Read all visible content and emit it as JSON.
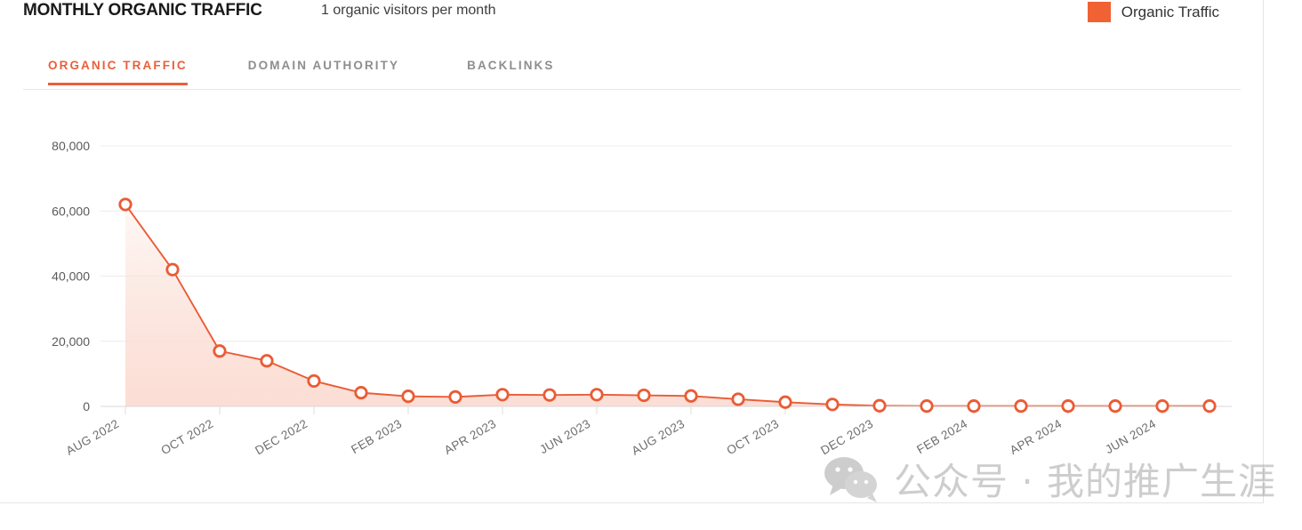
{
  "header": {
    "title": "MONTHLY ORGANIC TRAFFIC",
    "subtitle": "1 organic visitors per month",
    "legend": {
      "label": "Organic Traffic",
      "color": "#f06134"
    }
  },
  "tabs": [
    {
      "label": "ORGANIC TRAFFIC",
      "active": true
    },
    {
      "label": "DOMAIN AUTHORITY",
      "active": false
    },
    {
      "label": "BACKLINKS",
      "active": false
    }
  ],
  "watermark": {
    "text": "公众号 · 我的推广生涯"
  },
  "colors": {
    "accent": "#e8603c",
    "line": "#ea5b35",
    "legend_swatch": "#f06134",
    "area_fill": "#fbe0d7",
    "grid": "#ececec",
    "tab_inactive": "#8e8e8e"
  },
  "chart_data": {
    "type": "line",
    "title": "MONTHLY ORGANIC TRAFFIC",
    "subtitle": "1 organic visitors per month",
    "xlabel": "",
    "ylabel": "",
    "ylim": [
      0,
      80000
    ],
    "yticks": [
      0,
      20000,
      40000,
      60000,
      80000
    ],
    "ytick_labels": [
      "0",
      "20,000",
      "40,000",
      "60,000",
      "80,000"
    ],
    "grid": true,
    "legend_position": "top-right",
    "xtick_labels": [
      "AUG 2022",
      "OCT 2022",
      "DEC 2022",
      "FEB 2023",
      "APR 2023",
      "JUN 2023",
      "AUG 2023",
      "OCT 2023",
      "DEC 2023",
      "FEB 2024",
      "APR 2024",
      "JUN 2024"
    ],
    "x": [
      "AUG 2022",
      "SEP 2022",
      "OCT 2022",
      "NOV 2022",
      "DEC 2022",
      "JAN 2023",
      "FEB 2023",
      "MAR 2023",
      "APR 2023",
      "MAY 2023",
      "JUN 2023",
      "JUL 2023",
      "AUG 2023",
      "SEP 2023",
      "OCT 2023",
      "NOV 2023",
      "DEC 2023",
      "JAN 2024",
      "FEB 2024",
      "MAR 2024",
      "APR 2024",
      "MAY 2024",
      "JUN 2024",
      "JUL 2024"
    ],
    "series": [
      {
        "name": "Organic Traffic",
        "color": "#ea5b35",
        "values": [
          62000,
          42000,
          17000,
          14000,
          7800,
          4200,
          3100,
          2900,
          3600,
          3500,
          3600,
          3400,
          3200,
          2200,
          1300,
          600,
          200,
          100,
          100,
          100,
          100,
          100,
          100,
          100
        ]
      }
    ]
  }
}
